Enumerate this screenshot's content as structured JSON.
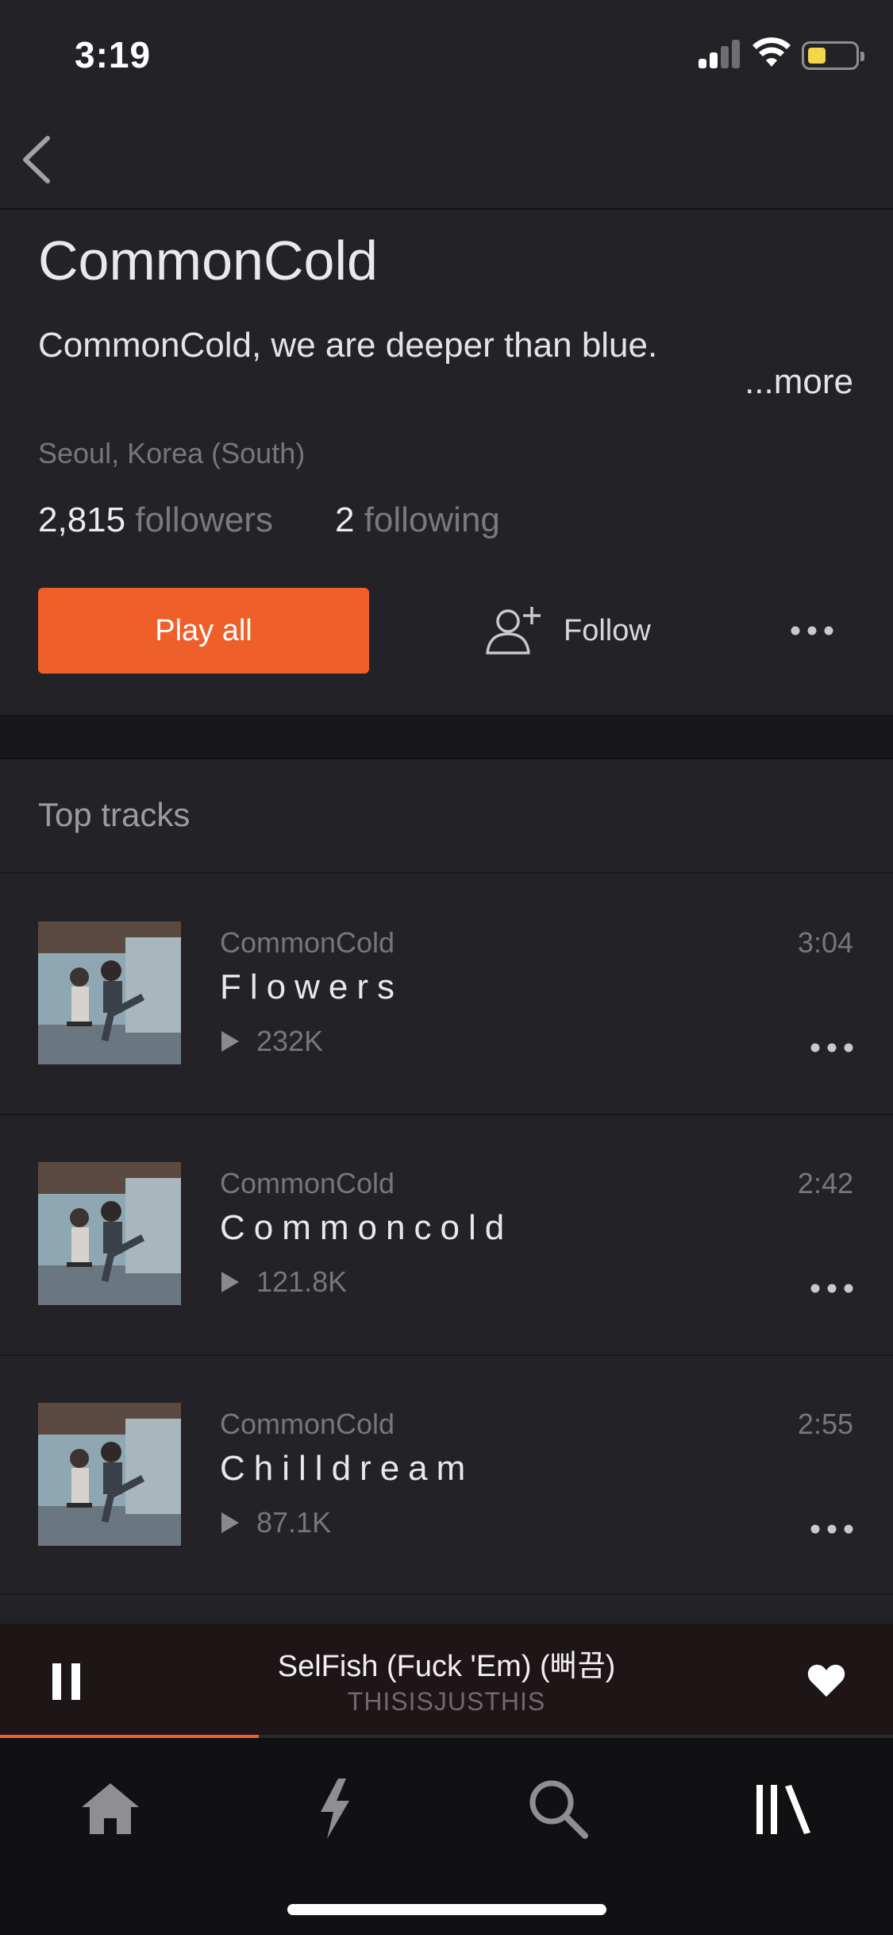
{
  "status_bar": {
    "time": "3:19"
  },
  "profile": {
    "name": "CommonCold",
    "bio": "CommonCold, we are deeper than blue.",
    "bio_more": "...more",
    "location": "Seoul, Korea (South)",
    "followers_count": "2,815",
    "followers_label": "followers",
    "following_count": "2",
    "following_label": "following"
  },
  "actions": {
    "play_all": "Play all",
    "follow": "Follow"
  },
  "top_tracks": {
    "title": "Top tracks",
    "items": [
      {
        "artist": "CommonCold",
        "title": "Flowers",
        "plays": "232K",
        "duration": "3:04"
      },
      {
        "artist": "CommonCold",
        "title": "Commoncold",
        "plays": "121.8K",
        "duration": "2:42"
      },
      {
        "artist": "CommonCold",
        "title": "Chilldream",
        "plays": "87.1K",
        "duration": "2:55"
      }
    ]
  },
  "now_playing": {
    "title": "SelFish (Fuck 'Em) (뻐끔)",
    "artist": "THISISJUSTHIS",
    "progress": 0.29,
    "liked": true
  },
  "tabs": [
    {
      "icon": "home-icon"
    },
    {
      "icon": "lightning-icon"
    },
    {
      "icon": "search-icon"
    },
    {
      "icon": "library-icon"
    }
  ],
  "colors": {
    "accent": "#ee5f29",
    "background": "#232226"
  }
}
